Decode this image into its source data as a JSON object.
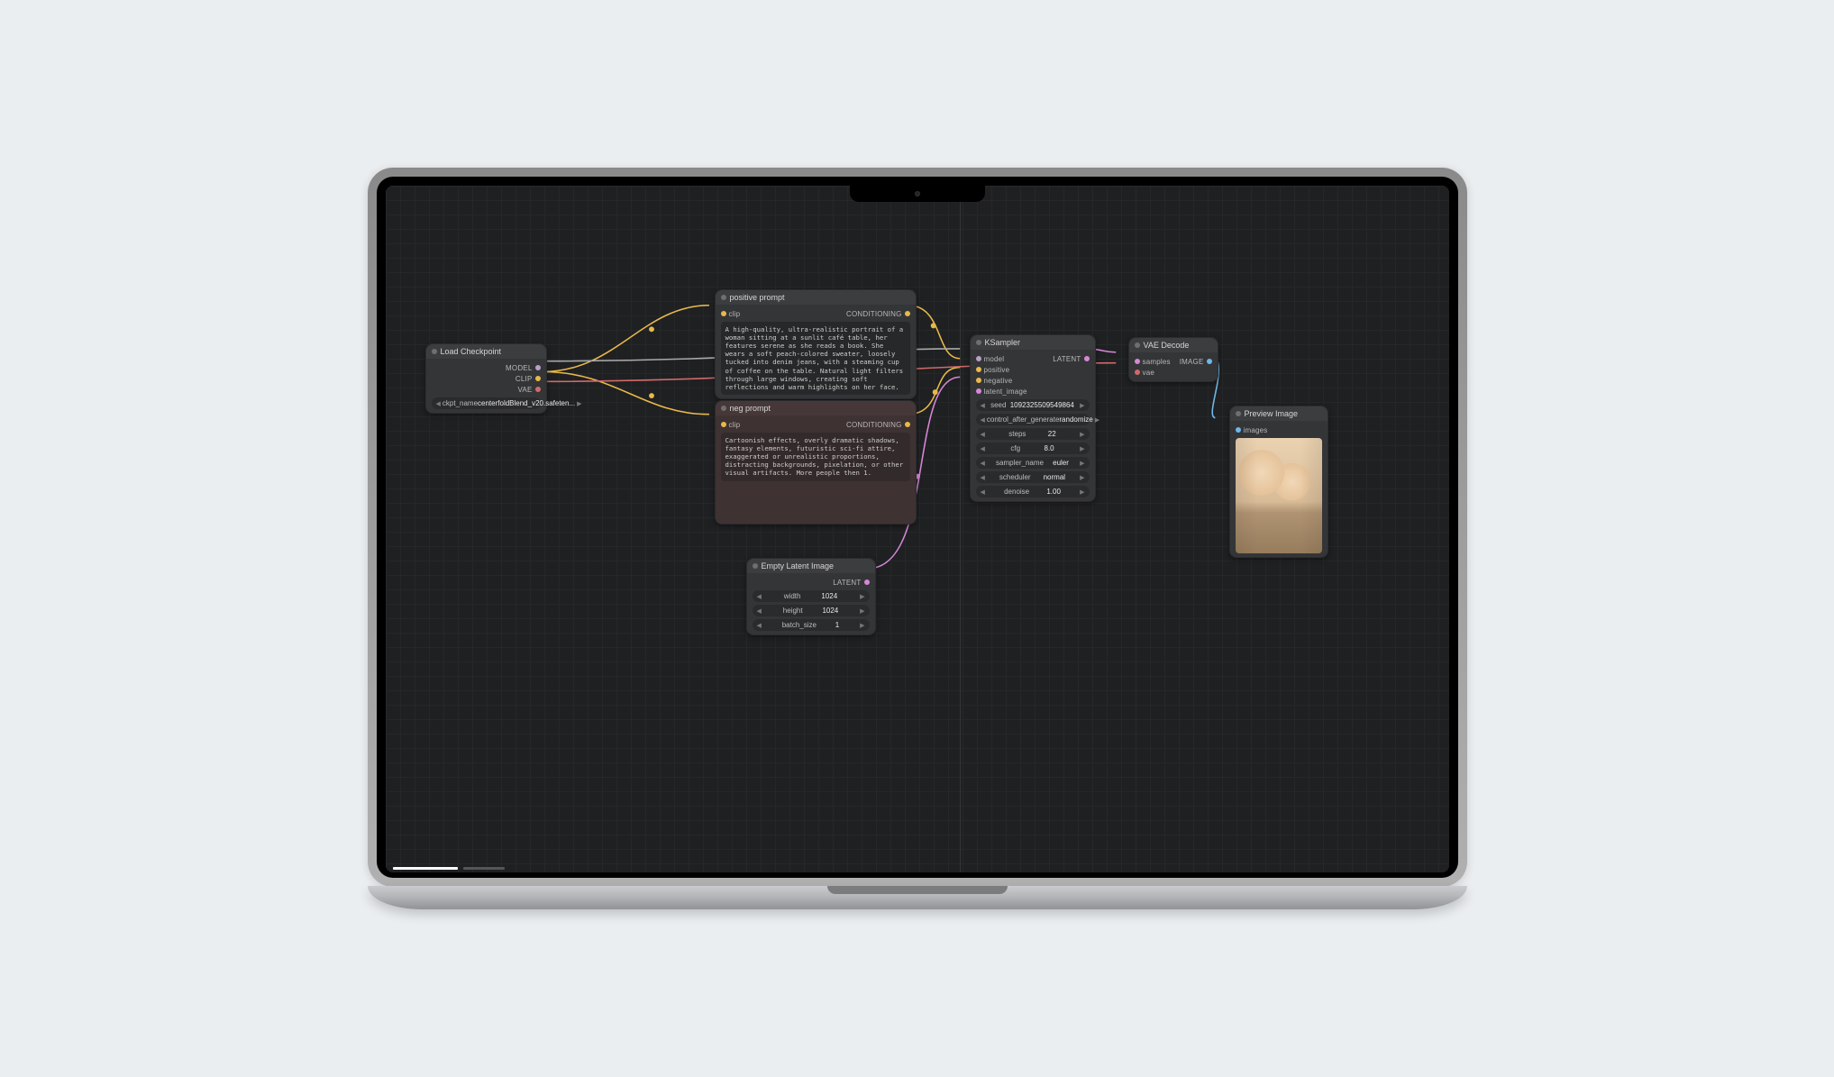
{
  "nodes": {
    "checkpoint": {
      "title": "Load Checkpoint",
      "outputs": {
        "model": "MODEL",
        "clip": "CLIP",
        "vae": "VAE"
      },
      "param_key": "ckpt_name",
      "param_value": "centerfoldBlend_v20.safeten..."
    },
    "pos": {
      "title": "positive prompt",
      "input_label": "clip",
      "output_label": "CONDITIONING",
      "text": "A high-quality, ultra-realistic portrait of a woman sitting at a sunlit café table, her features serene as she reads a book. She wears a soft peach-colored sweater, loosely tucked into denim jeans, with a steaming cup of coffee on the table. Natural light filters through large windows, creating soft reflections and warm highlights on her face."
    },
    "neg": {
      "title": "neg prompt",
      "input_label": "clip",
      "output_label": "CONDITIONING",
      "text": "Cartoonish effects, overly dramatic shadows, fantasy elements, futuristic sci-fi attire, exaggerated or unrealistic proportions, distracting backgrounds, pixelation, or other visual artifacts. More people then 1."
    },
    "empty": {
      "title": "Empty Latent Image",
      "output_label": "LATENT",
      "params": [
        {
          "k": "width",
          "v": "1024"
        },
        {
          "k": "height",
          "v": "1024"
        },
        {
          "k": "batch_size",
          "v": "1"
        }
      ]
    },
    "ksampler": {
      "title": "KSampler",
      "inputs": {
        "model": "model",
        "positive": "positive",
        "negative": "negative",
        "latent": "latent_image"
      },
      "output_label": "LATENT",
      "params": [
        {
          "k": "seed",
          "v": "1092325509549864"
        },
        {
          "k": "control_after_generate",
          "v": "randomize"
        },
        {
          "k": "steps",
          "v": "22"
        },
        {
          "k": "cfg",
          "v": "8.0"
        },
        {
          "k": "sampler_name",
          "v": "euler"
        },
        {
          "k": "scheduler",
          "v": "normal"
        },
        {
          "k": "denoise",
          "v": "1.00"
        }
      ]
    },
    "vae": {
      "title": "VAE Decode",
      "inputs": {
        "samples": "samples",
        "vae": "vae"
      },
      "output_label": "IMAGE"
    },
    "preview": {
      "title": "Preview Image",
      "input_label": "images"
    }
  }
}
